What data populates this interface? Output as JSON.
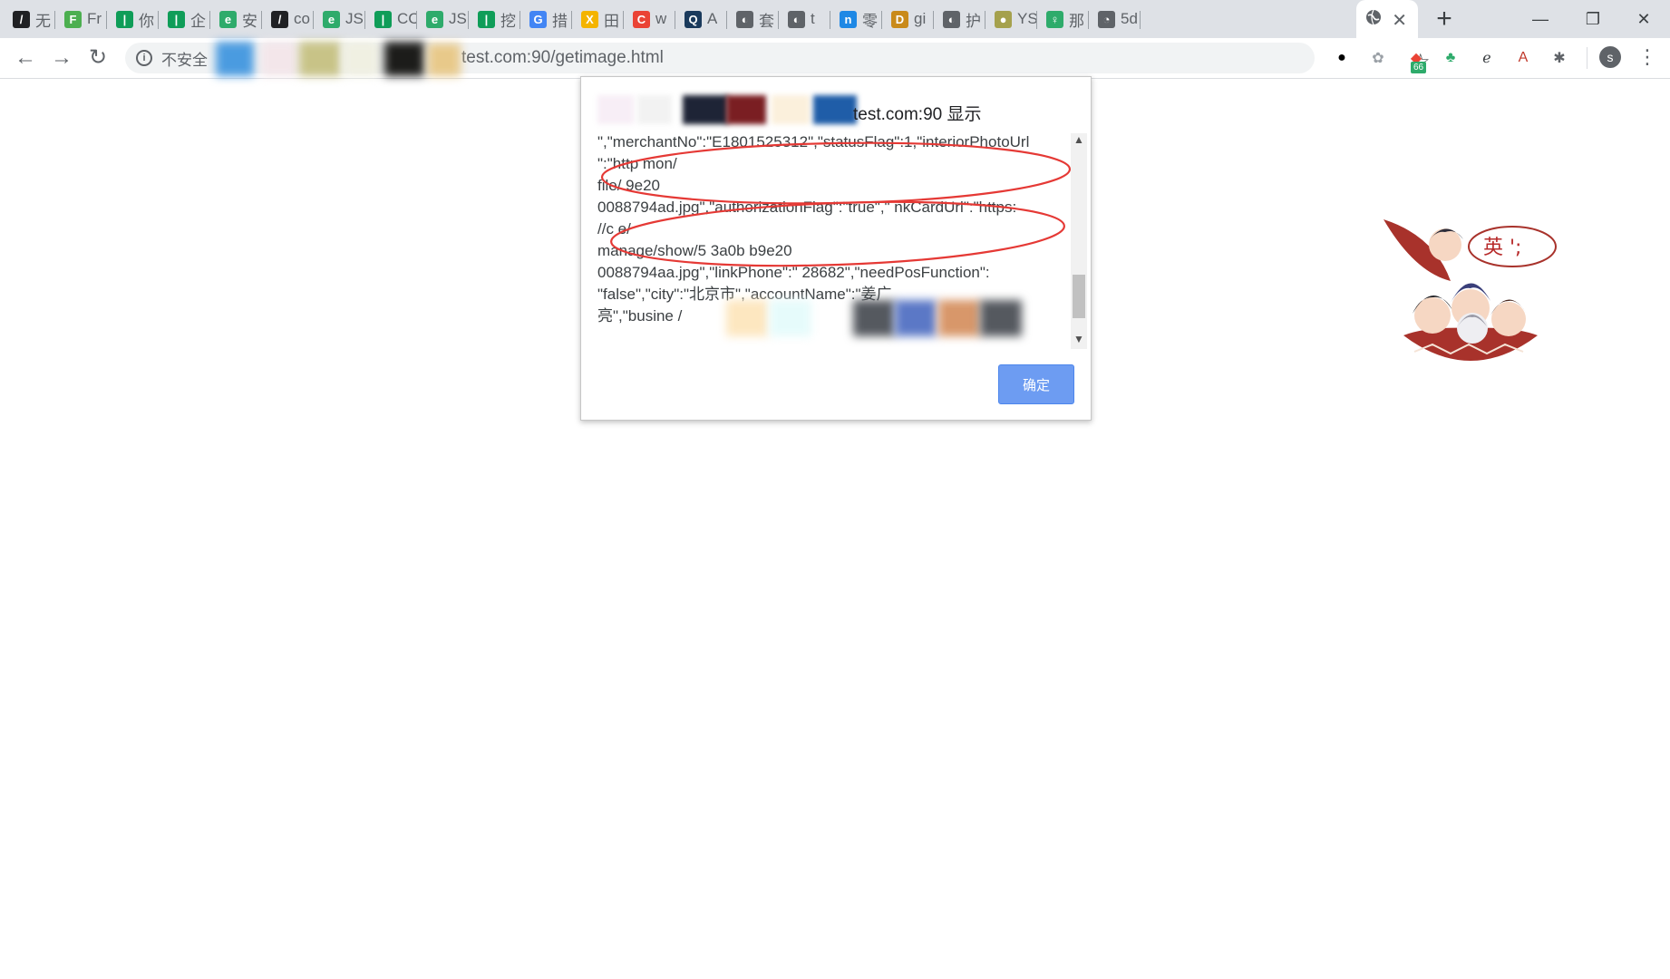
{
  "tabs": [
    {
      "label": "无",
      "color": "#202124",
      "glyph": "/"
    },
    {
      "label": "Fr",
      "color": "#4caf50",
      "glyph": "F"
    },
    {
      "label": "你",
      "color": "#0f9d58",
      "glyph": "|"
    },
    {
      "label": "企",
      "color": "#0f9d58",
      "glyph": "|"
    },
    {
      "label": "安",
      "color": "#2eab6b",
      "glyph": "e"
    },
    {
      "label": "co",
      "color": "#202124",
      "glyph": "/"
    },
    {
      "label": "JS",
      "color": "#2eab6b",
      "glyph": "e"
    },
    {
      "label": "CC",
      "color": "#0f9d58",
      "glyph": "|"
    },
    {
      "label": "JS",
      "color": "#2eab6b",
      "glyph": "e"
    },
    {
      "label": "挖",
      "color": "#0f9d58",
      "glyph": "|"
    },
    {
      "label": "措",
      "color": "#4285f4",
      "glyph": "G"
    },
    {
      "label": "田",
      "color": "#f4b400",
      "glyph": "X"
    },
    {
      "label": "w",
      "color": "#ea4335",
      "glyph": "C"
    },
    {
      "label": "A",
      "color": "#1a3a5c",
      "glyph": "Q"
    },
    {
      "label": "套",
      "color": "#5f6368",
      "glyph": "◐"
    },
    {
      "label": "t",
      "color": "#5f6368",
      "glyph": "◐"
    },
    {
      "label": "零",
      "color": "#1e88e5",
      "glyph": "n"
    },
    {
      "label": "gi",
      "color": "#c98a1a",
      "glyph": "D"
    },
    {
      "label": "护",
      "color": "#5f6368",
      "glyph": "◐"
    },
    {
      "label": "YS",
      "color": "#a5a14d",
      "glyph": "●"
    },
    {
      "label": "那",
      "color": "#2eab6b",
      "glyph": "♀"
    },
    {
      "label": "5d",
      "color": "#5f6368",
      "glyph": "◔"
    }
  ],
  "active_tab": {
    "glyph": "globe",
    "close": "✕"
  },
  "new_tab": "+",
  "window": {
    "minimize": "—",
    "restore": "❐",
    "close": "✕"
  },
  "toolbar": {
    "back": "←",
    "forward": "→",
    "reload": "↻"
  },
  "omnibox": {
    "security_label": "不安全",
    "url_visible": "test.com:90/getimage.html",
    "star": "☆"
  },
  "extensions": [
    {
      "name": "circle-icon",
      "glyph": "●",
      "color": "#000000"
    },
    {
      "name": "puzzle-icon",
      "glyph": "✿",
      "color": "#9aa0a6"
    },
    {
      "name": "badge-ext-icon",
      "glyph": "◆",
      "color": "#ea4335",
      "badge": "66"
    },
    {
      "name": "evernote-icon",
      "glyph": "♣",
      "color": "#2eab6b"
    },
    {
      "name": "translate-icon",
      "glyph": "ℯ",
      "color": "#3c4043"
    },
    {
      "name": "pdf-icon",
      "glyph": "A",
      "color": "#c0392b"
    },
    {
      "name": "settings-ext-icon",
      "glyph": "✱",
      "color": "#5f6368"
    }
  ],
  "profile": {
    "initial": "s"
  },
  "dialog": {
    "title_suffix": "test.com:90 显示",
    "message_lines": [
      "\",\"merchantNo\":\"E1801525312\",\"statusFlag\":1,\"interiorPhotoUrl",
      "\":\"http                                     mon/",
      "file/                                    9e20",
      "0088794ad.jpg\",\"authorizationFlag\":\"true\",\"   nkCardUrl\":\"https:",
      "//c                                          e/",
      "manage/show/5   3a0b   b9e20",
      "0088794aa.jpg\",\"linkPhone\":\"       28682\",\"needPosFunction\":",
      "\"false\",\"city\":\"北京市\",\"accountName\":\"姜广",
      "亮\",\"busine                                      /",
      "                                                "
    ],
    "ok_label": "确定"
  },
  "mascot": {
    "text": "英 ';"
  }
}
